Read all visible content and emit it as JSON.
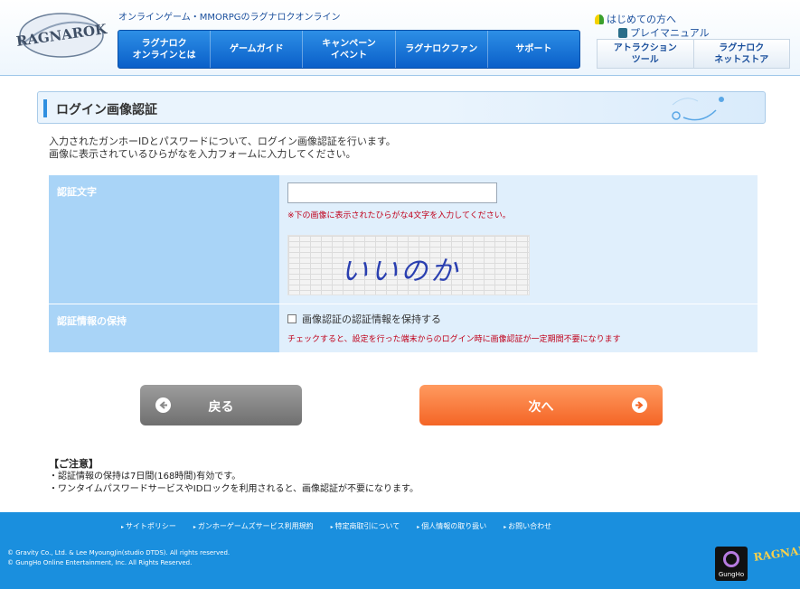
{
  "header": {
    "logo_text": "RAGNAROK",
    "tagline": "オンラインゲーム・MMORPGのラグナロクオンライン",
    "nav": [
      {
        "label": "ラグナロク\nオンラインとは"
      },
      {
        "label": "ゲームガイド"
      },
      {
        "label": "キャンペーン\nイベント"
      },
      {
        "label": "ラグナロクファン"
      },
      {
        "label": "サポート"
      }
    ],
    "links": {
      "beginner": "はじめての方へ",
      "manual": "プレイマニュアル"
    },
    "side_buttons": [
      {
        "label": "アトラクション\nツール"
      },
      {
        "label": "ラグナロク\nネットストア"
      }
    ]
  },
  "page": {
    "title": "ログイン画像認証",
    "intro_line1": "入力されたガンホーIDとパスワードについて、ログイン画像認証を行います。",
    "intro_line2": "画像に表示されているひらがなを入力フォームに入力してください。"
  },
  "form": {
    "auth_label": "認証文字",
    "auth_value": "",
    "auth_note": "※下の画像に表示されたひらがな4文字を入力してください。",
    "captcha_text": "いいのか",
    "keep_label": "認証情報の保持",
    "keep_checkbox_label": "画像認証の認証情報を保持する",
    "keep_note": "チェックすると、設定を行った端末からのログイン時に画像認証が一定期間不要になります"
  },
  "buttons": {
    "back": "戻る",
    "next": "次へ"
  },
  "notes": {
    "title": "【ご注意】",
    "line1": "・認証情報の保持は7日間(168時間)有効です。",
    "line2": "・ワンタイムパスワードサービスやIDロックを利用されると、画像認証が不要になります。"
  },
  "footer": {
    "links": [
      "サイトポリシー",
      "ガンホーゲームズサービス利用規約",
      "特定商取引について",
      "個人情報の取り扱い",
      "お問い合わせ"
    ],
    "copyright1": "© Gravity Co., Ltd. & Lee MyoungJin(studio DTDS). All rights reserved.",
    "copyright2": "© GungHo Online Entertainment, Inc. All Rights Reserved.",
    "logo1_text": "GungHo",
    "logo2_text": "RAGNAROK"
  },
  "colors": {
    "nav_blue": "#0a5fc9",
    "label_cell": "#a9d4f7",
    "value_cell": "#e0effc",
    "note_red": "#c0001a",
    "next_orange": "#f46526",
    "back_gray": "#7a7a7a",
    "footer_blue": "#1a8fde"
  }
}
